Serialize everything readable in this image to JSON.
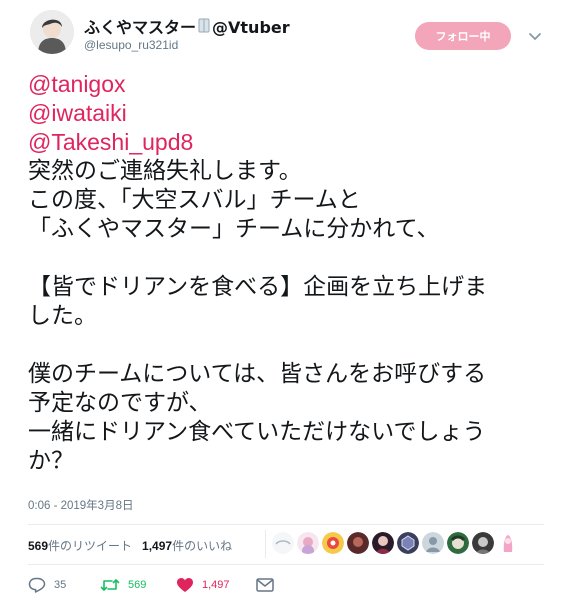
{
  "author": {
    "display_name": "ふくやマスター",
    "name_suffix": "@Vtuber",
    "handle": "@lesupo_ru321id"
  },
  "follow_button": {
    "label": "フォロー中"
  },
  "tweet": {
    "lines": [
      "@tanigox",
      "@iwataiki",
      "@Takeshi_upd8",
      "突然のご連絡失礼します。",
      "この度、「大空スバル」チームと",
      "「ふくやマスター」チームに分かれて、",
      "",
      "【皆でドリアンを食べる】企画を立ち上げま",
      "した。",
      "",
      "僕のチームについては、皆さんをお呼びする",
      "予定なのですが、",
      "一緒にドリアン食べていただけないでしょう",
      "か？"
    ],
    "timestamp": "0:06 - 2019年3月8日"
  },
  "stats": {
    "retweet_count": "569",
    "retweet_label": "件のリツイート",
    "like_count": "1,497",
    "like_label": "件のいいね"
  },
  "actions": {
    "reply_count": "35",
    "retweet_count": "569",
    "like_count": "1,497"
  },
  "colors": {
    "mention": "#e0245e",
    "follow_bg": "#f3a5b9",
    "retweet": "#17bf63",
    "like": "#e0245e",
    "secondary_text": "#657786"
  },
  "icons": {
    "reply": "reply-icon",
    "retweet": "retweet-icon",
    "like": "heart-icon",
    "message": "envelope-icon",
    "caret": "chevron-down-icon"
  }
}
